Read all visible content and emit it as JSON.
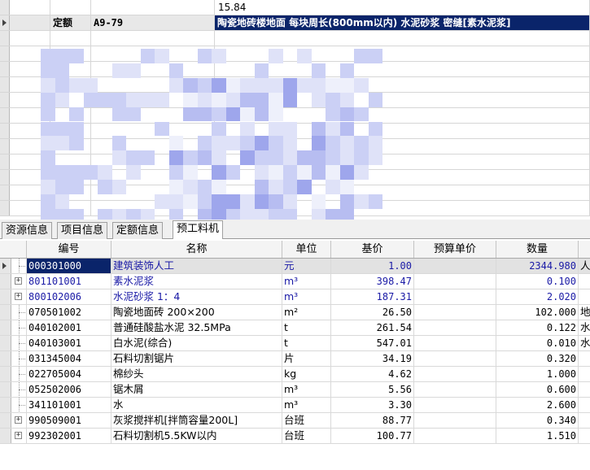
{
  "top_grid": {
    "first_row_value": "15.84",
    "selected_row": {
      "type": "定额",
      "code": "A9-79",
      "description": "陶瓷地砖楼地面 每块周长(800mm以内)  水泥砂浆 密缝[素水泥浆]"
    }
  },
  "tabs": [
    {
      "label": "资源信息"
    },
    {
      "label": "项目信息"
    },
    {
      "label": "定额信息"
    },
    {
      "label": "预工料机"
    }
  ],
  "table": {
    "headers": [
      "编号",
      "名称",
      "单位",
      "基价",
      "预算单价",
      "数量"
    ],
    "rows": [
      {
        "code": "000301000",
        "name": "建筑装饰人工",
        "unit": "元",
        "base_price": "1.00",
        "budget_price": "",
        "quantity": "2344.980",
        "extra": "人",
        "expandable": false
      },
      {
        "code": "801101001",
        "name": "素水泥浆",
        "unit": "m³",
        "base_price": "398.47",
        "budget_price": "",
        "quantity": "0.100",
        "extra": "",
        "expandable": true
      },
      {
        "code": "800102006",
        "name": "水泥砂浆 1：4",
        "unit": "m³",
        "base_price": "187.31",
        "budget_price": "",
        "quantity": "2.020",
        "extra": "",
        "expandable": true
      },
      {
        "code": "070501002",
        "name": "陶瓷地面砖 200×200",
        "unit": "m²",
        "base_price": "26.50",
        "budget_price": "",
        "quantity": "102.000",
        "extra": "地",
        "expandable": false
      },
      {
        "code": "040102001",
        "name": "普通硅酸盐水泥 32.5MPa",
        "unit": "t",
        "base_price": "261.54",
        "budget_price": "",
        "quantity": "0.122",
        "extra": "水",
        "expandable": false
      },
      {
        "code": "040103001",
        "name": "白水泥(综合)",
        "unit": "t",
        "base_price": "547.01",
        "budget_price": "",
        "quantity": "0.010",
        "extra": "水",
        "expandable": false
      },
      {
        "code": "031345004",
        "name": "石料切割锯片",
        "unit": "片",
        "base_price": "34.19",
        "budget_price": "",
        "quantity": "0.320",
        "extra": "",
        "expandable": false
      },
      {
        "code": "022705004",
        "name": "棉纱头",
        "unit": "kg",
        "base_price": "4.62",
        "budget_price": "",
        "quantity": "1.000",
        "extra": "",
        "expandable": false
      },
      {
        "code": "052502006",
        "name": "锯木屑",
        "unit": "m³",
        "base_price": "5.56",
        "budget_price": "",
        "quantity": "0.600",
        "extra": "",
        "expandable": false
      },
      {
        "code": "341101001",
        "name": "水",
        "unit": "m³",
        "base_price": "3.30",
        "budget_price": "",
        "quantity": "2.600",
        "extra": "",
        "expandable": false
      },
      {
        "code": "990509001",
        "name": "灰浆搅拌机[拌筒容量200L]",
        "unit": "台班",
        "base_price": "88.77",
        "budget_price": "",
        "quantity": "0.340",
        "extra": "",
        "expandable": true
      },
      {
        "code": "992302001",
        "name": "石料切割机5.5KW以内",
        "unit": "台班",
        "base_price": "100.77",
        "budget_price": "",
        "quantity": "1.510",
        "extra": "",
        "expandable": true
      }
    ]
  },
  "colors": {
    "selection": "#0a246a",
    "link_text": "#1a1aa6",
    "grid_line": "#d6d6d6"
  }
}
